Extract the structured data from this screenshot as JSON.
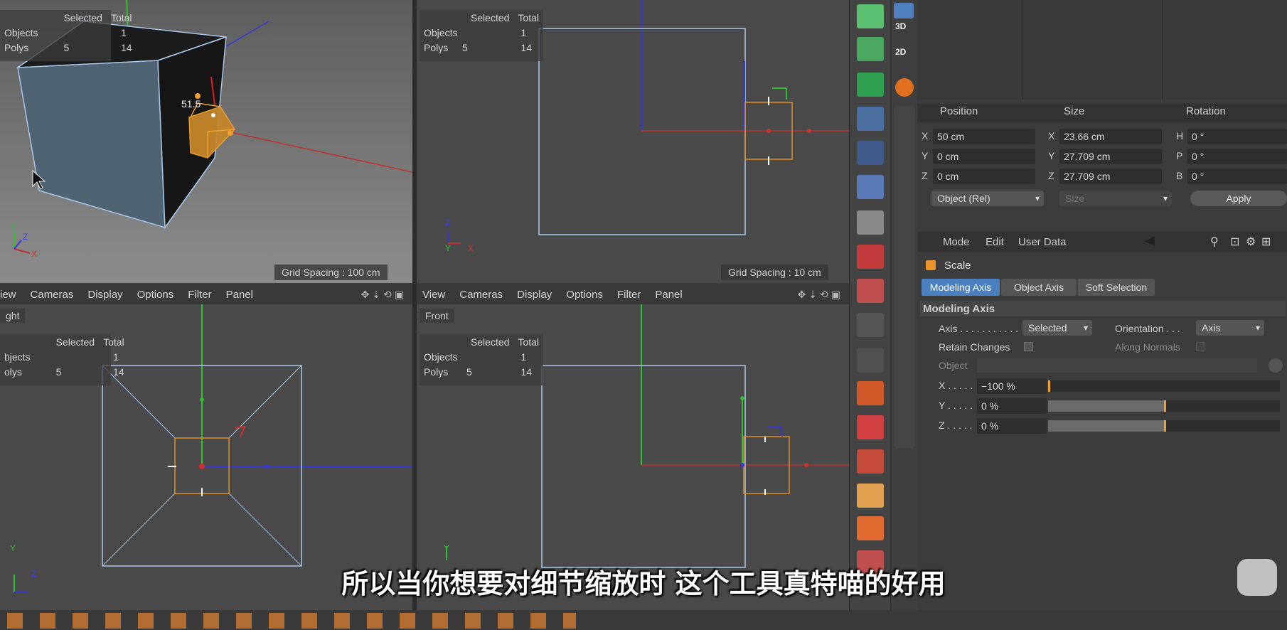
{
  "viewport_persp": {
    "hud_header_selected": "Selected",
    "hud_header_total": "Total",
    "hud_row1_label": "Objects",
    "hud_row1_selected": "",
    "hud_row1_total": "1",
    "hud_row2_label": "Polys",
    "hud_row2_selected": "5",
    "hud_row2_total": "14",
    "measure_label": "51.5",
    "grid_spacing": "Grid Spacing : 100 cm",
    "axis_y": "Y",
    "axis_z": "Z",
    "axis_x": "X"
  },
  "viewport_top": {
    "hud_header_selected": "Selected",
    "hud_header_total": "Total",
    "hud_row1_label": "Objects",
    "hud_row1_total": "1",
    "hud_row2_label": "Polys",
    "hud_row2_selected": "5",
    "hud_row2_total": "14",
    "grid_spacing": "Grid Spacing : 10 cm",
    "axis_z": "Z",
    "axis_y": "Y",
    "axis_x": "X"
  },
  "viewport_right": {
    "menu": [
      "iew",
      "Cameras",
      "Display",
      "Options",
      "Filter",
      "Panel"
    ],
    "name": "ght",
    "hud_header_selected": "Selected",
    "hud_header_total": "Total",
    "hud_row1_label": "bjects",
    "hud_row1_total": "1",
    "hud_row2_label": "olys",
    "hud_row2_selected": "5",
    "hud_row2_total": "14",
    "axis_y": "Y",
    "axis_z": "Z"
  },
  "viewport_front": {
    "menu": [
      "View",
      "Cameras",
      "Display",
      "Options",
      "Filter",
      "Panel"
    ],
    "name": "Front",
    "hud_header_selected": "Selected",
    "hud_header_total": "Total",
    "hud_row1_label": "Objects",
    "hud_row1_total": "1",
    "hud_row2_label": "Polys",
    "hud_row2_selected": "5",
    "hud_row2_total": "14",
    "axis_y": "Y"
  },
  "mode_tabs": {
    "d3": "3D",
    "d2": "2D"
  },
  "coords": {
    "head_position": "Position",
    "head_size": "Size",
    "head_rotation": "Rotation",
    "rows": [
      {
        "pl": "X",
        "pv": "50 cm",
        "sl": "X",
        "sv": "23.66 cm",
        "rl": "H",
        "rv": "0 °"
      },
      {
        "pl": "Y",
        "pv": "0 cm",
        "sl": "Y",
        "sv": "27.709 cm",
        "rl": "P",
        "rv": "0 °"
      },
      {
        "pl": "Z",
        "pv": "0 cm",
        "sl": "Z",
        "sv": "27.709 cm",
        "rl": "B",
        "rv": "0 °"
      }
    ],
    "object_mode": "Object (Rel)",
    "size_mode": "Size",
    "apply": "Apply"
  },
  "attributes": {
    "menu_mode": "Mode",
    "menu_edit": "Edit",
    "menu_user_data": "User Data",
    "tool_name": "Scale",
    "tabs": [
      "Modeling Axis",
      "Object Axis",
      "Soft Selection"
    ],
    "section": "Modeling Axis",
    "axis_label": "Axis . . . . . . . . . . .",
    "axis_value": "Selected",
    "orientation_label": "Orientation . . .",
    "orientation_value": "Axis",
    "retain_label": "Retain Changes",
    "along_normals_label": "Along Normals",
    "object_label": "Object",
    "x_label": "X . . . . .",
    "x_value": "−100 %",
    "x_fraction": 0.0,
    "y_label": "Y . . . . .",
    "y_value": "0 %",
    "y_fraction": 0.5,
    "z_label": "Z . . . . .",
    "z_value": "0 %",
    "z_fraction": 0.5
  },
  "subtitle": "所以当你想要对细节缩放时 这个工具真特喵的好用",
  "colors": {
    "x_axis": "#d03030",
    "y_axis": "#30c030",
    "z_axis": "#2a2ad8",
    "selection": "#e0902a",
    "wire": "#a9c7e8",
    "tab_active": "#4a7fc0"
  }
}
